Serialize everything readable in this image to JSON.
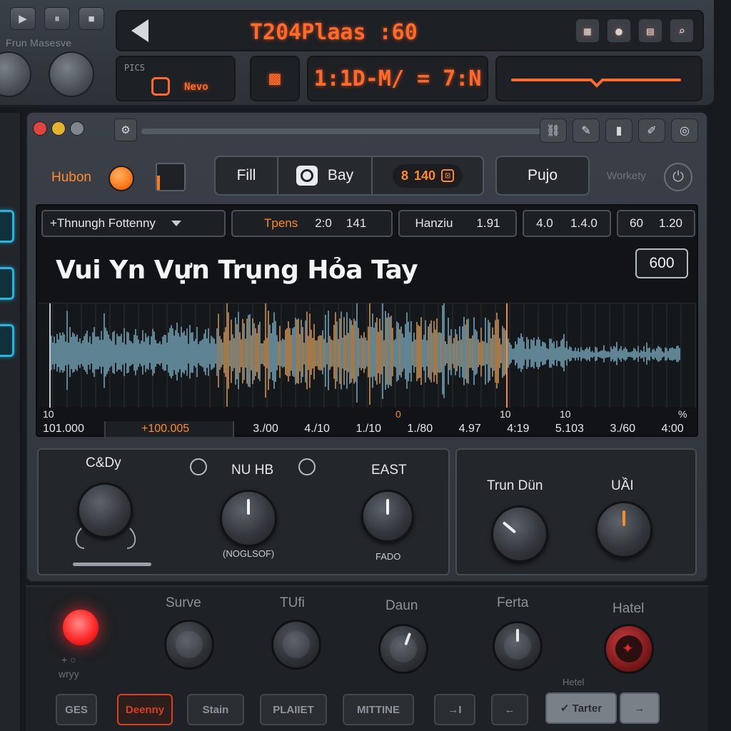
{
  "transport": {
    "caption": "Frun Masesve",
    "buttons": [
      "▶",
      "⏸",
      "■"
    ],
    "display": "T204Plaas :60",
    "icons": [
      "grid-icon",
      "user-icon",
      "document-icon",
      "search-icon"
    ],
    "sub1_label": "PICS",
    "sub1_value": "Nevo",
    "sub3_value": "1:1D-M/ = 7:N"
  },
  "window": {
    "toolbar_icons": [
      "link-icon",
      "edit-icon",
      "levels-icon",
      "brush-icon",
      "settings-icon"
    ],
    "hubon_label": "Hubon",
    "seg_fill": "Fill",
    "seg_bay": "Bay",
    "seg_counter_a": "8",
    "seg_counter_b": "140",
    "pujo_label": "Pujo",
    "workety_label": "Workety"
  },
  "editor": {
    "font_select": "+Thnungh Fottenny",
    "fields": [
      {
        "label": "Tpens",
        "v1": "2:0",
        "v2": "141"
      },
      {
        "label": "Hanziu",
        "v1": "1.91"
      },
      {
        "label": "4.0",
        "v1": "1.4.0"
      },
      {
        "label": "60",
        "v1": "1.20"
      }
    ],
    "badge": "600",
    "song_title": "Vui Yn Vựn Trụng Hỏa Tay",
    "scale": [
      "10",
      "0",
      "10",
      "10",
      "%"
    ],
    "time_left": "101.000",
    "time_orange": "+100.005",
    "time_values": [
      "3./00",
      "4./10",
      "1./10",
      "1./80",
      "4.97",
      "4:19",
      "5.103",
      "3./60",
      "4:00"
    ]
  },
  "knobs_left": {
    "k1_label": "C&Dy",
    "k2_label": "NU HB",
    "k2_sub": "(NOGLSOF)",
    "k3_label": "EAST",
    "k3_sub": "FADO"
  },
  "knobs_right": {
    "k1_label": "Trun Dün",
    "k2_label": "UẦI"
  },
  "deck": {
    "small1": "+ ○",
    "small2": "wryy",
    "knob_labels": [
      "Surve",
      "TUfi",
      "Daun",
      "Ferta",
      "Hatel"
    ],
    "buttons": [
      "GES",
      "Deenny",
      "Stain",
      "PLAIIET",
      "MITTINE",
      "→I",
      "←"
    ],
    "meta_label": "Hetel",
    "meta_btn_a": "✔ Tarter",
    "meta_btn_b": "→"
  },
  "colors": {
    "accent": "#ff8a2a",
    "lcd": "#ff6a2a",
    "wave_blue": "#7fb4c9",
    "wave_orange": "#e3a15a",
    "rec": "#ff2a2a",
    "edge_cyan": "#1fb8e0"
  }
}
